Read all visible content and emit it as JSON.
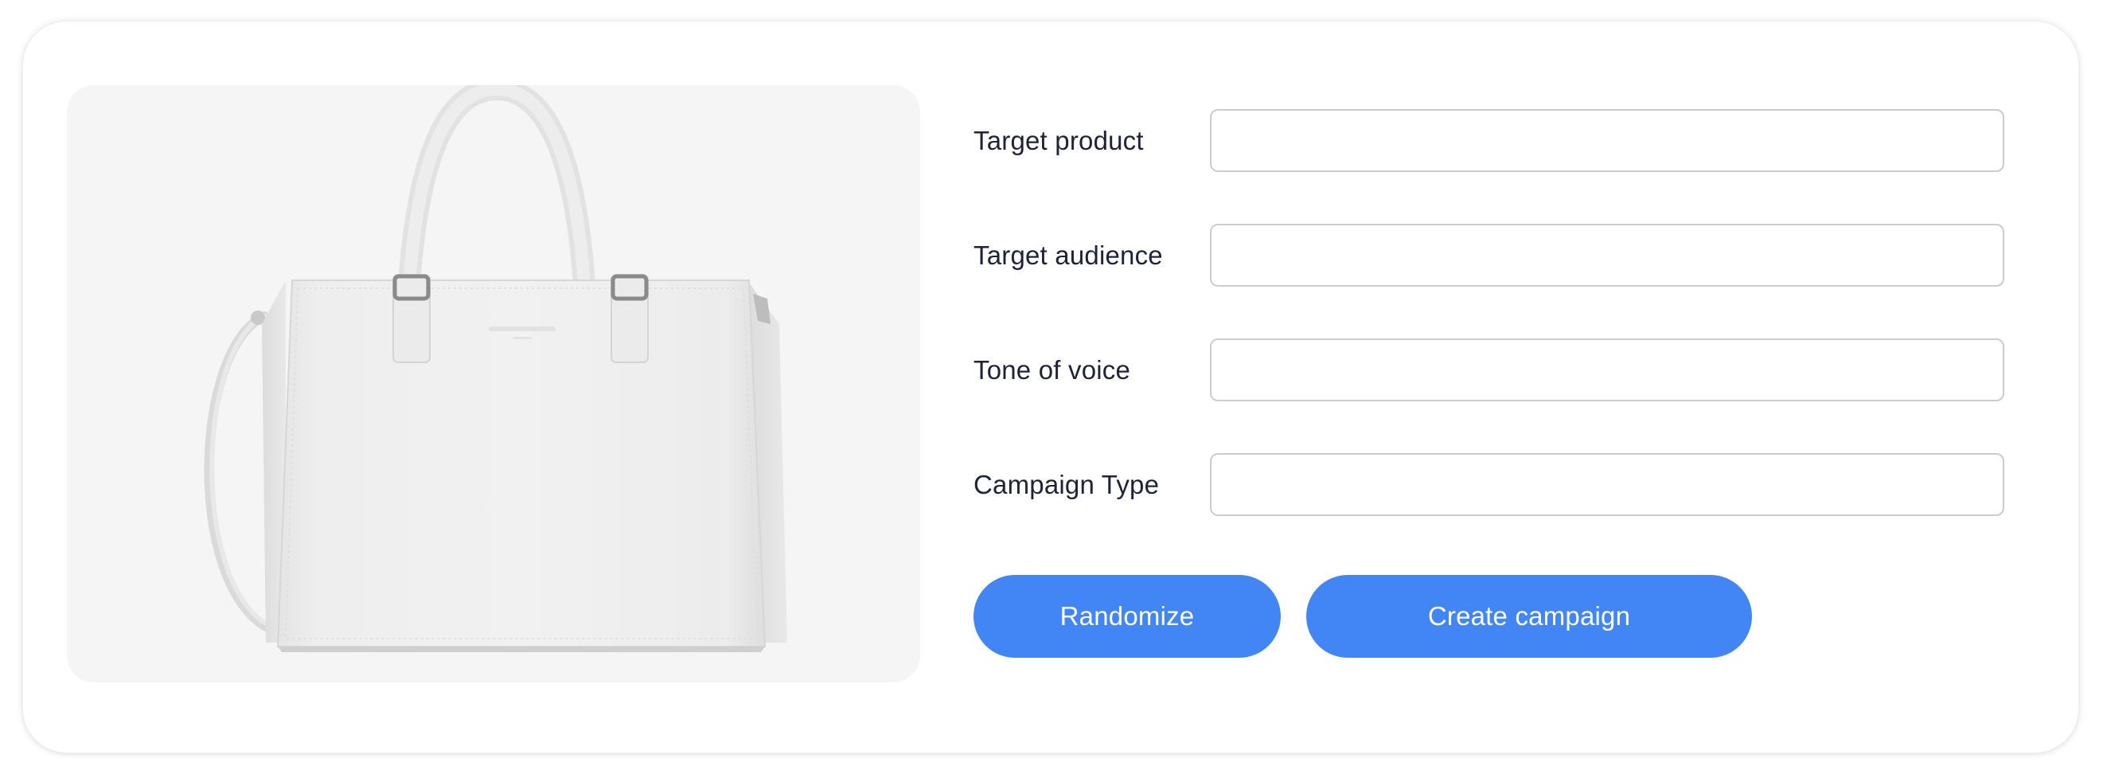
{
  "form": {
    "fields": [
      {
        "label": "Target product",
        "value": "",
        "placeholder": ""
      },
      {
        "label": "Target audience",
        "value": "",
        "placeholder": ""
      },
      {
        "label": "Tone of voice",
        "value": "",
        "placeholder": ""
      },
      {
        "label": "Campaign Type",
        "value": "",
        "placeholder": ""
      }
    ],
    "randomize_label": "Randomize",
    "create_label": "Create campaign"
  },
  "colors": {
    "accent": "#4285f4",
    "label_text": "#1f2338",
    "image_background": "#f5f5f5",
    "input_border": "#cccccc"
  }
}
